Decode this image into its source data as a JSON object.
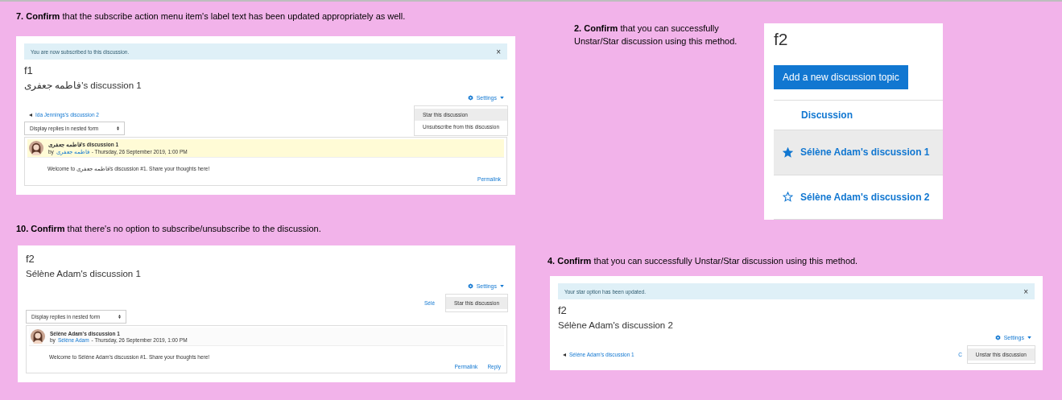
{
  "steps": [
    {
      "kind": "page",
      "instruction": "**7. Confirm** that the subscribe action menu item's label text has been updated appropriately as well.",
      "page": {
        "alert": "You are now subscribed to this discussion.",
        "close": "×",
        "course": "f1",
        "title": "فاطمه جعفری's discussion 1",
        "settings": "Settings",
        "menu": [
          {
            "label": "Star this discussion",
            "selected": true
          },
          {
            "label": "Unsubscribe from this discussion",
            "selected": false
          }
        ],
        "prev_link": "Ida Jennings's discussion 2",
        "select": "Display replies in nested form",
        "post": {
          "subject": "فاطمه جعفری's discussion 1",
          "by": "by",
          "author": "فاطمه جعفری",
          "date": "- Thursday, 26 September 2019, 1:00 PM",
          "body": "Welcome to فاطمه جعفری's discussion #1. Share your thoughts here!",
          "highlighted": true,
          "actions": [
            "Permalink"
          ]
        }
      }
    },
    {
      "kind": "list",
      "instruction": "**2. Confirm** that you can successfully Unstar/Star discussion using this method.",
      "page": {
        "course": "f2",
        "add_button": "Add a new discussion topic",
        "column": "Discussion",
        "rows": [
          {
            "title": "Sélène Adam's discussion 1",
            "starred": true,
            "selected": true
          },
          {
            "title": "Sélène Adam's discussion 2",
            "starred": false,
            "selected": false
          }
        ]
      }
    },
    {
      "kind": "page",
      "instruction": "**10. Confirm** that there's no option to subscribe/unsubscribe to the discussion.",
      "page": {
        "course": "f2",
        "title": "Sélène Adam's discussion 1",
        "settings": "Settings",
        "menu": [
          {
            "label": "Star this discussion",
            "selected": true
          }
        ],
        "next_link": "Sélè",
        "select": "Display replies in nested form",
        "post": {
          "subject": "Sélène Adam's discussion 1",
          "by": "by",
          "author": "Sélène Adam",
          "date": "- Thursday, 26 September 2019, 1:00 PM",
          "body": "Welcome to Sélène Adam's discussion #1. Share your thoughts here!",
          "highlighted": false,
          "actions": [
            "Permalink",
            "Reply"
          ]
        }
      }
    },
    {
      "kind": "page",
      "instruction": "**4. Confirm** that you can successfully Unstar/Star discussion using this method.",
      "page": {
        "alert": "Your star option has been updated.",
        "close": "×",
        "course": "f2",
        "title": "Sélène Adam's discussion 2",
        "settings": "Settings",
        "menu": [
          {
            "label": "Unstar this discussion",
            "selected": true
          }
        ],
        "prev_link": "Sélène Adam's discussion 1",
        "next_link": "C"
      }
    }
  ]
}
